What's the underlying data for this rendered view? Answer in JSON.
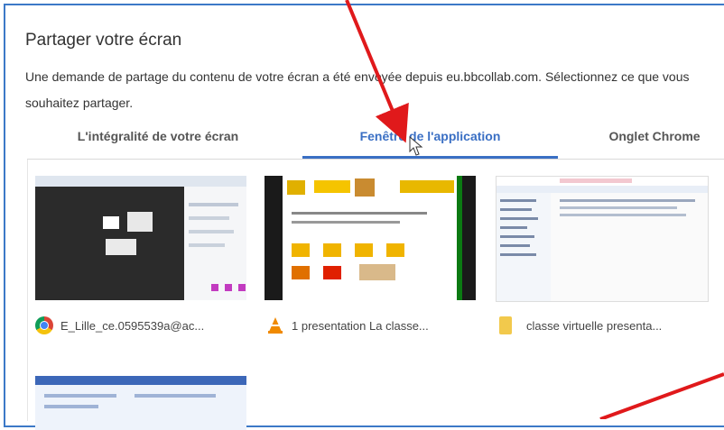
{
  "dialog": {
    "title": "Partager votre écran",
    "description": "Une demande de partage du contenu de votre écran a été envoyée depuis eu.bbcollab.com. Sélectionnez ce que vous souhaitez partager."
  },
  "tabs": [
    {
      "label": "L'intégralité de votre écran",
      "active": false
    },
    {
      "label": "Fenêtre de l'application",
      "active": true
    },
    {
      "label": "Onglet Chrome",
      "active": false
    }
  ],
  "windows": [
    {
      "label": "E_Lille_ce.0595539a@ac...",
      "icon": "chrome-icon"
    },
    {
      "label": "1 presentation La classe...",
      "icon": "vlc-icon"
    },
    {
      "label": "classe virtuelle presenta...",
      "icon": "folder-icon"
    },
    {
      "label": "",
      "icon": "window"
    }
  ],
  "annotation": {
    "arrow_color": "#e0191b"
  }
}
